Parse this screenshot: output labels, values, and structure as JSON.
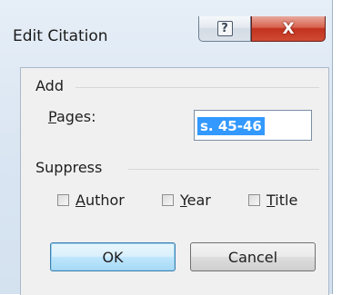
{
  "window": {
    "title": "Edit Citation",
    "help_glyph": "?",
    "close_glyph": "X"
  },
  "add_group": {
    "title": "Add",
    "pages_label_mnemonic": "P",
    "pages_label_rest": "ages:",
    "pages_value": "s. 45-46"
  },
  "suppress_group": {
    "title": "Suppress",
    "options": [
      {
        "mnemonic": "A",
        "rest": "uthor",
        "checked": false
      },
      {
        "mnemonic": "Y",
        "rest": "ear",
        "checked": false
      },
      {
        "mnemonic": "T",
        "rest": "itle",
        "checked": false
      }
    ]
  },
  "buttons": {
    "ok_label": "OK",
    "cancel_label": "Cancel"
  },
  "colors": {
    "selection": "#3399ff",
    "close_red": "#c2321e",
    "default_button_border": "#3c7fb1"
  }
}
